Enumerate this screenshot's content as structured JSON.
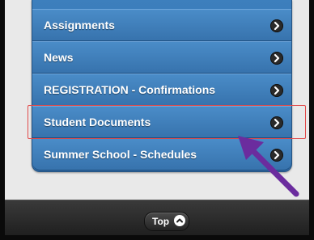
{
  "menu": {
    "items": [
      {
        "label": "Assignments"
      },
      {
        "label": "News"
      },
      {
        "label": "REGISTRATION - Confirmations"
      },
      {
        "label": "Student Documents"
      },
      {
        "label": "Summer School - Schedules"
      }
    ]
  },
  "footer": {
    "top_label": "Top"
  },
  "annotation": {
    "highlight_color": "#e14b4b",
    "arrow_color": "#6b2c9e"
  }
}
